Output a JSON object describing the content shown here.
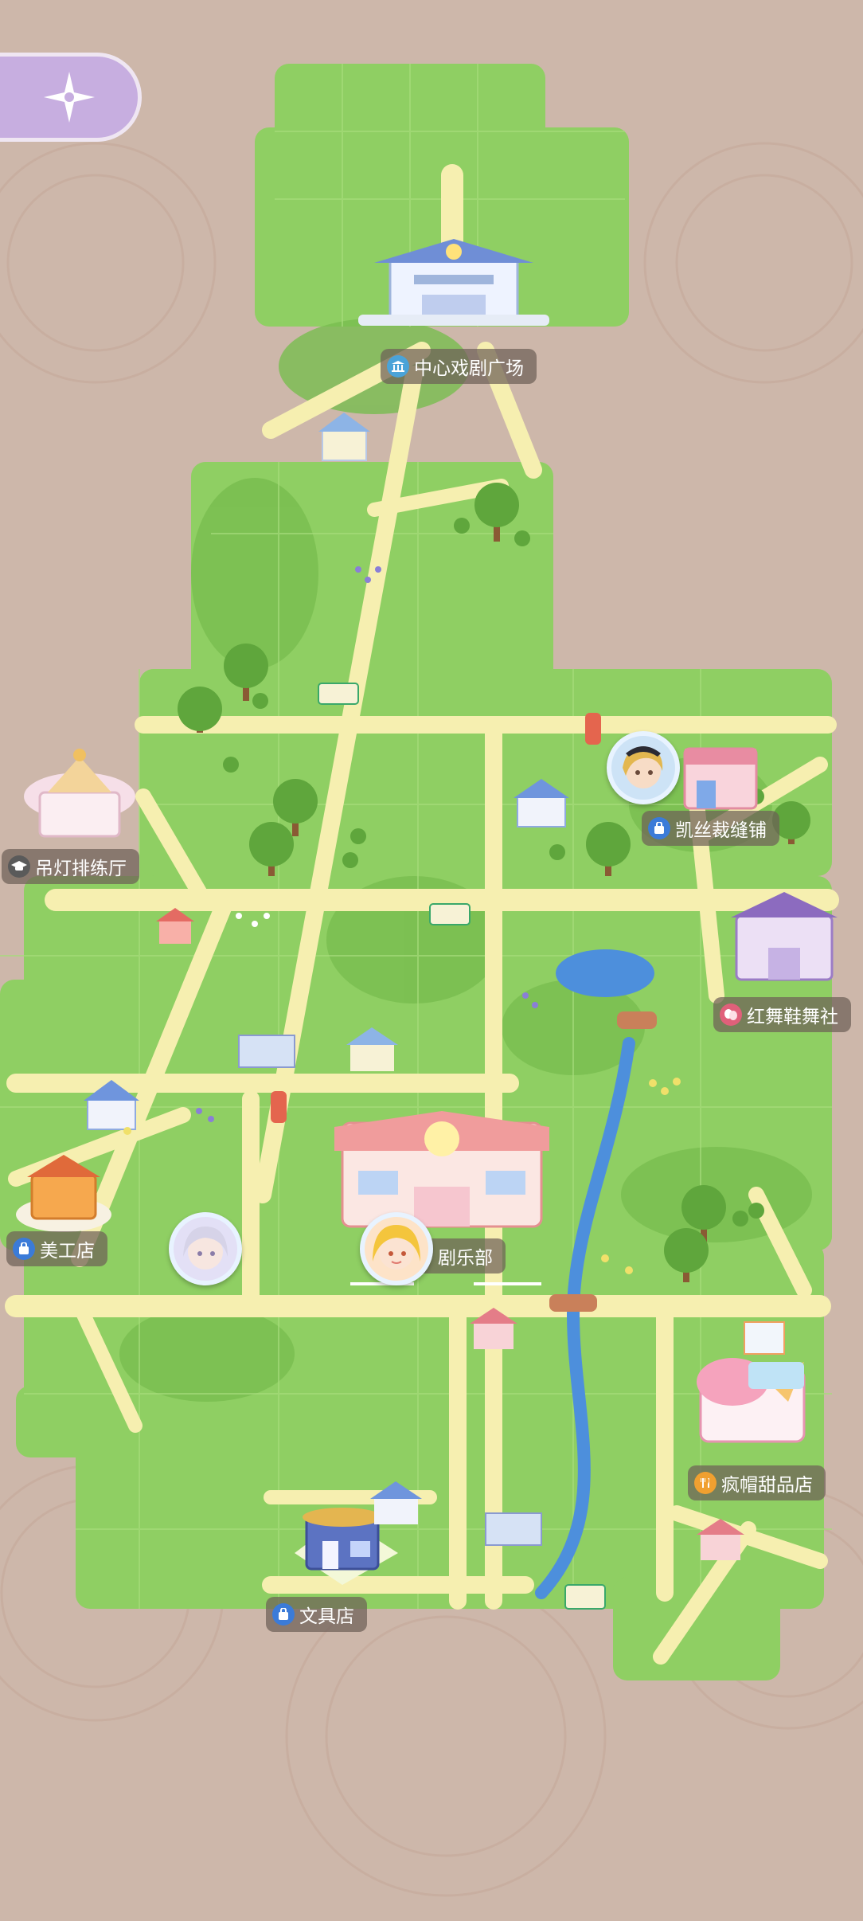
{
  "map": {
    "locations": [
      {
        "key": "central_square",
        "name": "中心戏剧广场",
        "icon": "theater-icon",
        "icon_color": "#4aa3d8"
      },
      {
        "key": "chandelier_hall",
        "name": "吊灯排练厅",
        "icon": "graduation-cap-icon",
        "icon_color": "#5a5a5a"
      },
      {
        "key": "tailor_shop",
        "name": "凯丝裁缝铺",
        "icon": "shopping-bag-icon",
        "icon_color": "#3b7bd8"
      },
      {
        "key": "dance_shoe_club",
        "name": "红舞鞋舞社",
        "icon": "drama-mask-icon",
        "icon_color": "#e0607a"
      },
      {
        "key": "art_supply_store",
        "name": "美工店",
        "icon": "shopping-bag-icon",
        "icon_color": "#3b7bd8"
      },
      {
        "key": "drama_club",
        "name": "剧乐部",
        "icon": "",
        "icon_color": ""
      },
      {
        "key": "dessert_shop",
        "name": "疯帽甜品店",
        "icon": "fork-knife-icon",
        "icon_color": "#f0a030"
      },
      {
        "key": "stationery_store",
        "name": "文具店",
        "icon": "shopping-bag-icon",
        "icon_color": "#3b7bd8"
      }
    ]
  },
  "colors": {
    "background": "#cdb7aa",
    "grass": "#8fcf63",
    "grass_dark": "#6fb548",
    "road": "#f6efb0",
    "river": "#4d8fdc",
    "label_bg": "#6e6058",
    "back_button": "#c7aee0"
  },
  "icons": {
    "back": "compass-star-icon"
  }
}
